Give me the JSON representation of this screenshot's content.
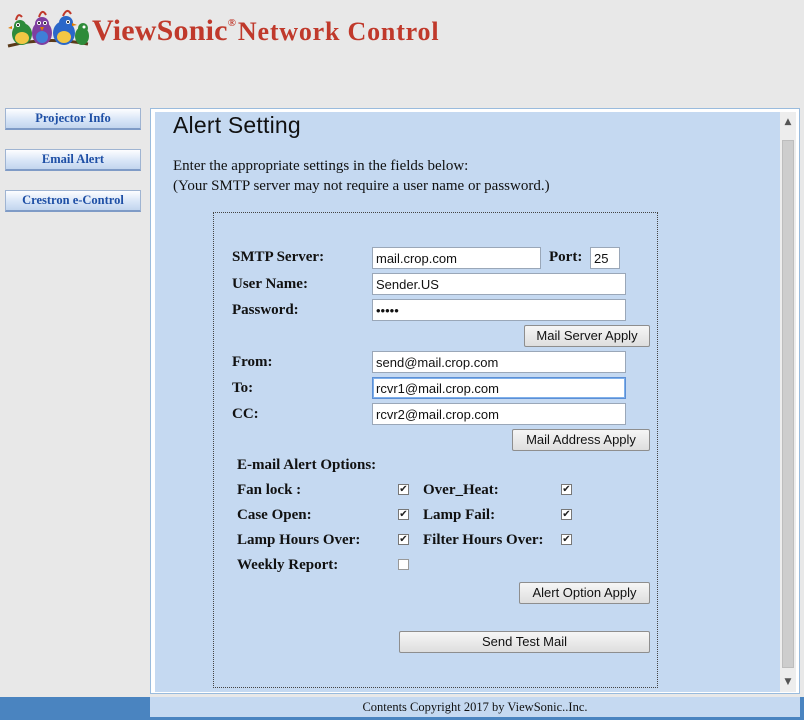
{
  "header": {
    "brand": "ViewSonic",
    "reg_mark": "®",
    "product": "Network Control"
  },
  "sidebar": {
    "items": [
      {
        "label": "Projector Info"
      },
      {
        "label": "Email Alert"
      },
      {
        "label": "Crestron e-Control"
      }
    ]
  },
  "main": {
    "title": "Alert Setting",
    "intro_line1": "Enter the appropriate settings in the fields below:",
    "intro_line2": "(Your SMTP server may not require a user name or password.)"
  },
  "server": {
    "smtp_label": "SMTP Server:",
    "smtp_value": "mail.crop.com",
    "port_label": "Port:",
    "port_value": "25",
    "username_label": "User Name:",
    "username_value": "Sender.US",
    "password_label": "Password:",
    "password_value": "12345",
    "apply_label": "Mail Server Apply"
  },
  "address": {
    "from_label": "From:",
    "from_value": "send@mail.crop.com",
    "to_label": "To:",
    "to_value": "rcvr1@mail.crop.com",
    "cc_label": "CC:",
    "cc_value": "rcvr2@mail.crop.com",
    "apply_label": "Mail Address Apply"
  },
  "alerts": {
    "heading": "E-mail Alert Options:",
    "options": [
      {
        "label": "Fan lock :",
        "checked": true
      },
      {
        "label": "Over_Heat:",
        "checked": true
      },
      {
        "label": "Case Open:",
        "checked": true
      },
      {
        "label": "Lamp Fail:",
        "checked": true
      },
      {
        "label": "Lamp Hours Over:",
        "checked": true
      },
      {
        "label": "Filter Hours Over:",
        "checked": true
      },
      {
        "label": "Weekly Report:",
        "checked": false
      }
    ],
    "apply_label": "Alert Option Apply",
    "test_label": "Send Test Mail"
  },
  "footer": {
    "copyright": "Contents Copyright 2017 by ViewSonic..Inc."
  },
  "icons": {
    "logo": "viewsonic-birds-logo",
    "check": "checkmark-icon"
  },
  "colors": {
    "brand_red": "#c0392b",
    "panel_bg": "#c5d9f1",
    "footer_blue": "#4a84c0",
    "nav_text": "#1e4fa5"
  }
}
